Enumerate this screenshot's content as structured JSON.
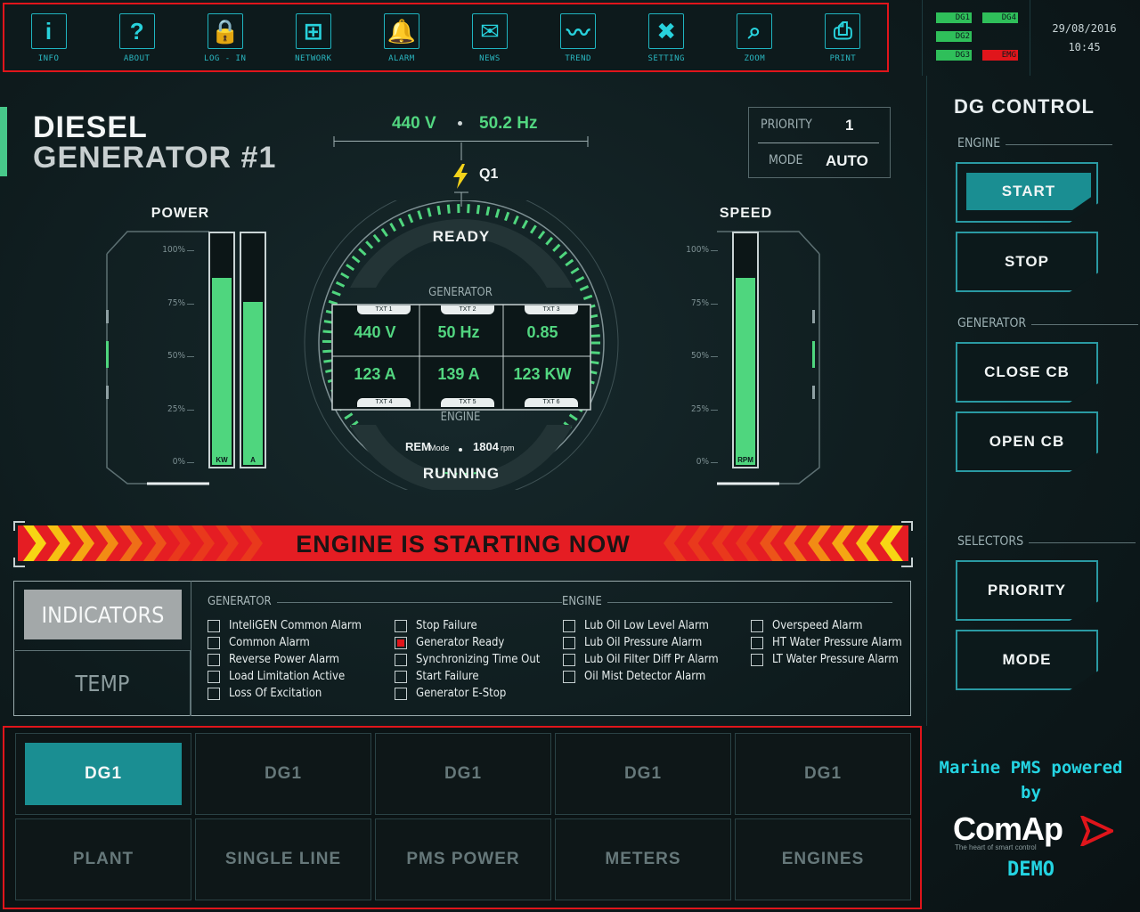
{
  "toolbar": {
    "items": [
      {
        "label": "INFO",
        "icon": "info-icon",
        "glyph": "i"
      },
      {
        "label": "ABOUT",
        "icon": "question-icon",
        "glyph": "?"
      },
      {
        "label": "LOG - IN",
        "icon": "lock-icon",
        "glyph": "🔒"
      },
      {
        "label": "NETWORK",
        "icon": "network-icon",
        "glyph": "⊞"
      },
      {
        "label": "ALARM",
        "icon": "bell-icon",
        "glyph": "🔔"
      },
      {
        "label": "NEWS",
        "icon": "whistle-icon",
        "glyph": "✉"
      },
      {
        "label": "TREND",
        "icon": "trend-icon",
        "glyph": "〰"
      },
      {
        "label": "SETTING",
        "icon": "tools-icon",
        "glyph": "✖"
      },
      {
        "label": "ZOOM",
        "icon": "zoom-icon",
        "glyph": "⌕"
      },
      {
        "label": "PRINT",
        "icon": "printer-icon",
        "glyph": "⎙"
      }
    ]
  },
  "status": {
    "indicators": [
      {
        "label": "DG1",
        "color": "#2fbf5a"
      },
      {
        "label": "DG4",
        "color": "#2fbf5a"
      },
      {
        "label": "DG2",
        "color": "#2fbf5a"
      },
      {
        "label": "DG3",
        "color": "#2fbf5a"
      },
      {
        "label": "EMG",
        "color": "#e0151b"
      }
    ],
    "date": "29/08/2016",
    "time": "10:45"
  },
  "title": {
    "line1": "DIESEL",
    "line2": "GENERATOR #1"
  },
  "bus": {
    "voltage": "440 V",
    "frequency": "50.2 Hz",
    "breaker": "Q1"
  },
  "priority": {
    "priority_label": "PRIORITY",
    "priority_value": "1",
    "mode_label": "MODE",
    "mode_value": "AUTO"
  },
  "power": {
    "title": "POWER",
    "ticks": [
      "100%",
      "75%",
      "50%",
      "25%",
      "0%"
    ],
    "bars": [
      {
        "label": "KW",
        "level_pct": 80
      },
      {
        "label": "A",
        "level_pct": 70
      }
    ]
  },
  "speed": {
    "title": "SPEED",
    "ticks": [
      "100%",
      "75%",
      "50%",
      "25%",
      "0%"
    ],
    "bars": [
      {
        "label": "RPM",
        "level_pct": 80
      }
    ]
  },
  "dial": {
    "status_top": "READY",
    "status_bottom": "RUNNING",
    "generator_label": "GENERATOR",
    "engine_label": "ENGINE",
    "cells": [
      {
        "tag": "TXT 1",
        "value": "440 V"
      },
      {
        "tag": "TXT 2",
        "value": "50 Hz"
      },
      {
        "tag": "TXT 3",
        "value": "0.85"
      },
      {
        "tag": "TXT 4",
        "value": "123 A"
      },
      {
        "tag": "TXT 5",
        "value": "139 A"
      },
      {
        "tag": "TXT 6",
        "value": "123 KW"
      }
    ],
    "rem": "REM",
    "rem_unit": "Mode",
    "rpm": "1804",
    "rpm_unit": "rpm"
  },
  "banner": {
    "text": "ENGINE IS STARTING NOW"
  },
  "indicators": {
    "tab_active": "INDICATORS",
    "tab_other": "TEMP",
    "generator_header": "GENERATOR",
    "engine_header": "ENGINE",
    "generator_col1": [
      {
        "label": "InteliGEN Common Alarm",
        "on": false
      },
      {
        "label": "Common Alarm",
        "on": false
      },
      {
        "label": "Reverse Power Alarm",
        "on": false
      },
      {
        "label": "Load Limitation Active",
        "on": false
      },
      {
        "label": "Loss Of Excitation",
        "on": false
      }
    ],
    "generator_col2": [
      {
        "label": "Stop Failure",
        "on": false
      },
      {
        "label": "Generator Ready",
        "on": true
      },
      {
        "label": "Synchronizing Time Out",
        "on": false
      },
      {
        "label": "Start Failure",
        "on": false
      },
      {
        "label": "Generator E-Stop",
        "on": false
      }
    ],
    "engine_col1": [
      {
        "label": "Lub Oil Low Level Alarm",
        "on": false
      },
      {
        "label": "Lub Oil Pressure Alarm",
        "on": false
      },
      {
        "label": "Lub Oil Filter Diff Pr Alarm",
        "on": false
      },
      {
        "label": "Oil Mist Detector Alarm",
        "on": false
      }
    ],
    "engine_col2": [
      {
        "label": "Overspeed Alarm",
        "on": false
      },
      {
        "label": "HT Water Pressure Alarm",
        "on": false
      },
      {
        "label": "LT Water Pressure Alarm",
        "on": false
      }
    ]
  },
  "sidebar": {
    "title": "DG CONTROL",
    "engine_label": "ENGINE",
    "start": "START",
    "stop": "STOP",
    "generator_label": "GENERATOR",
    "close_cb": "CLOSE CB",
    "open_cb": "OPEN CB",
    "selectors_label": "SELECTORS",
    "priority": "PRIORITY",
    "mode": "MODE"
  },
  "nav": {
    "row1": [
      "DG1",
      "DG1",
      "DG1",
      "DG1",
      "DG1"
    ],
    "row2": [
      "PLANT",
      "SINGLE LINE",
      "PMS POWER",
      "METERS",
      "ENGINES"
    ]
  },
  "brand": {
    "line1": "Marine PMS powered",
    "line2": "by",
    "logo": "ComAp",
    "tagline": "The heart of smart control",
    "demo": "DEMO"
  },
  "colors": {
    "accent": "#1a8e92",
    "value_green": "#52d680",
    "alarm_red": "#e0151b",
    "brand_cyan": "#24d4e2"
  }
}
